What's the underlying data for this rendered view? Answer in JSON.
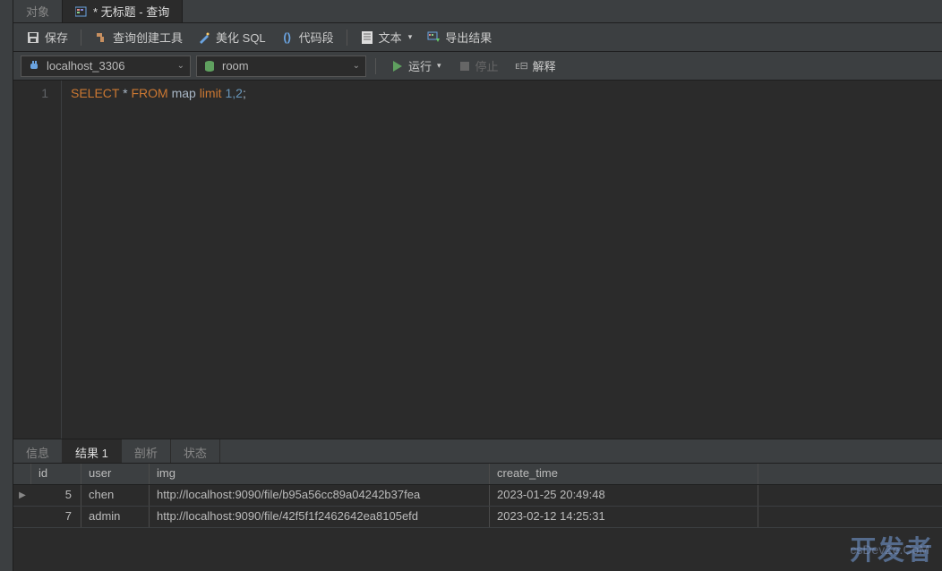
{
  "tabs": {
    "objects": "对象",
    "query": "* 无标题 - 查询"
  },
  "toolbar": {
    "save": "保存",
    "queryBuilder": "查询创建工具",
    "beautifySQL": "美化 SQL",
    "codeSnippet": "代码段",
    "text": "文本",
    "export": "导出结果"
  },
  "conn": {
    "connection": "localhost_3306",
    "database": "room",
    "run": "运行",
    "stop": "停止",
    "explain": "解释"
  },
  "editor": {
    "lineNum": "1",
    "kw1": "SELECT",
    "star": "*",
    "kw2": "FROM",
    "table": "map",
    "kw3": "limit",
    "args": "1,2",
    "semi": ";"
  },
  "bottomTabs": {
    "info": "信息",
    "result": "结果 1",
    "profile": "剖析",
    "status": "状态"
  },
  "resultTable": {
    "headers": {
      "id": "id",
      "user": "user",
      "img": "img",
      "create_time": "create_time"
    },
    "rows": [
      {
        "id": "5",
        "user": "chen",
        "img": "http://localhost:9090/file/b95a56cc89a04242b37fea",
        "create_time": "2023-01-25 20:49:48"
      },
      {
        "id": "7",
        "user": "admin",
        "img": "http://localhost:9090/file/42f5f1f2462642ea8105efd",
        "create_time": "2023-02-12 14:25:31"
      }
    ]
  },
  "watermark": {
    "main": "开发者",
    "sub": "csDevZe.CoM"
  }
}
